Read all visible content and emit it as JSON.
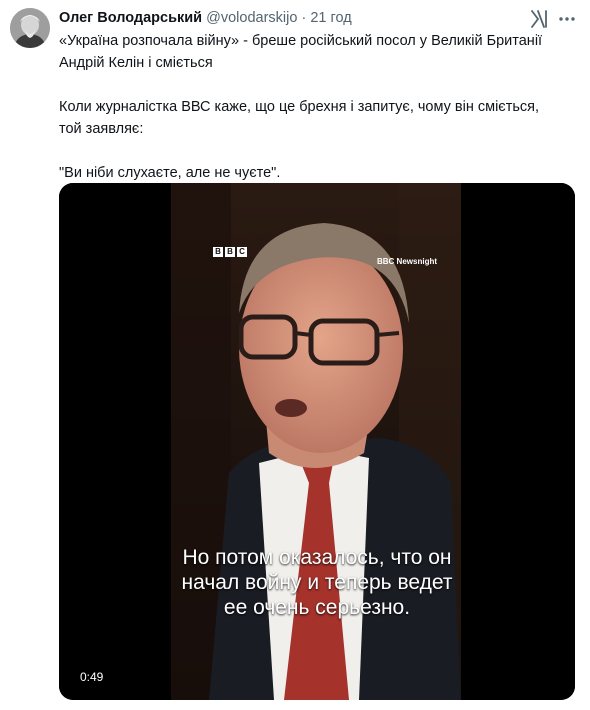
{
  "tweet": {
    "author_name": "Олег Володарський",
    "author_handle": "@volodarskijo",
    "separator": "·",
    "time": "21 год",
    "paragraphs": [
      "«Україна розпочала війну» - бреше російський посол у Великій Британії Андрій Келін і сміється",
      "Коли журналістка ВВС каже, що це брехня і запитує, чому він сміється, той заявляє:",
      "\"Ви ніби слухаєте, але не чуєте\"."
    ]
  },
  "icons": {
    "verified_x": "x-logo-icon",
    "more": "more-options-icon"
  },
  "media": {
    "bbc_letters": [
      "B",
      "B",
      "C"
    ],
    "channel_label": "BBC Newsnight",
    "subtitle": "Но потом оказалось, что он\nначал войну и теперь ведет\nее очень серьезно.",
    "duration": "0:49"
  },
  "colors": {
    "text_primary": "#0f1419",
    "text_secondary": "#536471",
    "media_bg": "#000000"
  }
}
